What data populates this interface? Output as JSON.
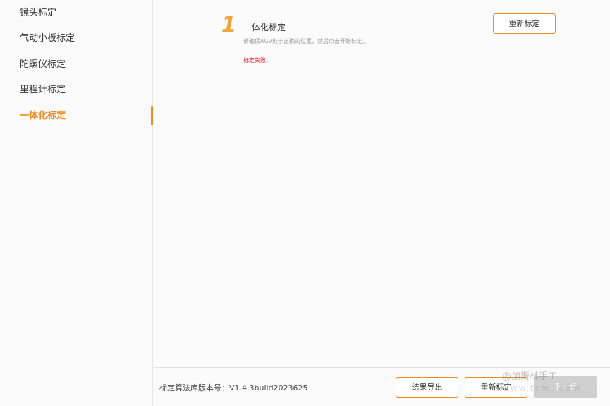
{
  "sidebar": {
    "items": [
      {
        "label": "镜头标定"
      },
      {
        "label": "气动小板标定"
      },
      {
        "label": "陀螺仪标定"
      },
      {
        "label": "里程计标定"
      },
      {
        "label": "一体化标定",
        "active": true
      }
    ]
  },
  "main": {
    "step_number": "1",
    "step_title": "一体化标定",
    "step_hint": "请确保AGV处于正确的位置，然后点击开始标定。",
    "status_text": "标定失败：",
    "recalibrate_button": "重新标定"
  },
  "footer": {
    "version_text": "标定算法库版本号：V1.4.3build2023625",
    "export_button": "结果导出",
    "recalibrate_button": "重新标定",
    "next_button": "下一步"
  },
  "watermark": {
    "line1": "@加斯林手工",
    "line2": "www.tcm..com"
  },
  "colors": {
    "accent": "#ef8a1d",
    "error": "#e0182a",
    "disabled": "#cfcfcf"
  }
}
